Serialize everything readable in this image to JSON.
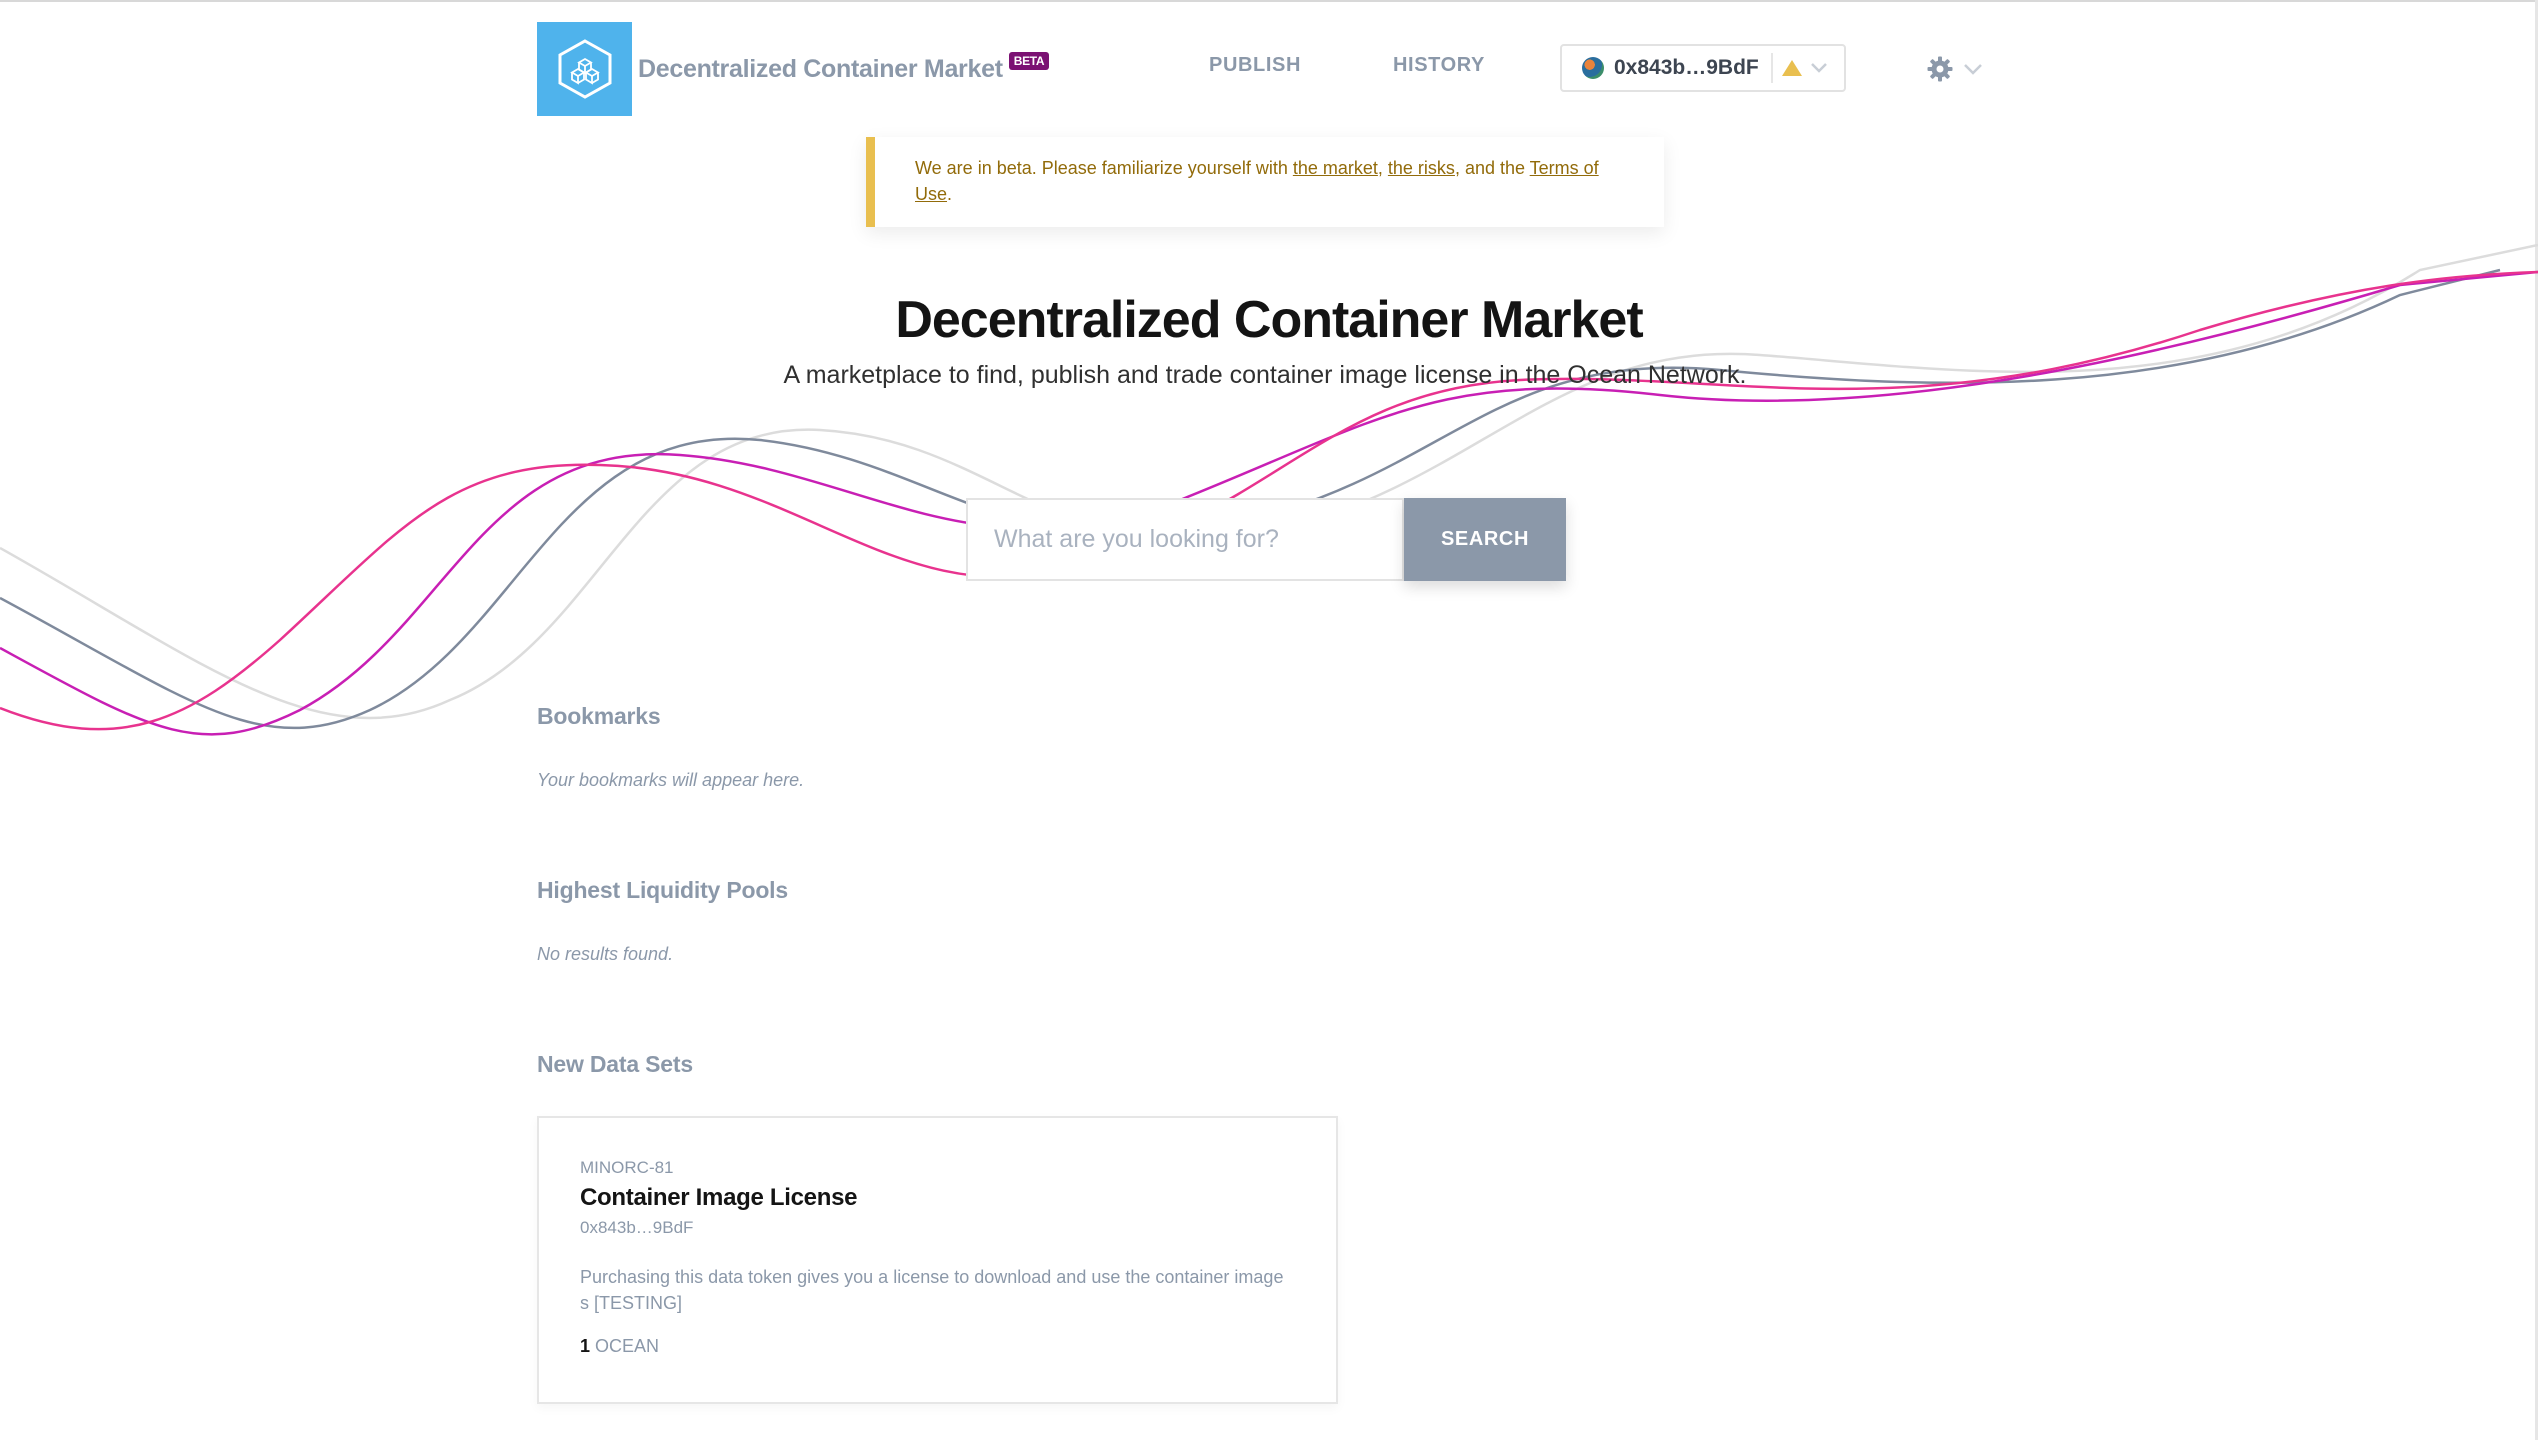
{
  "header": {
    "brand": "Decentralized Container Market",
    "badge": "BETA",
    "nav": [
      {
        "label": "PUBLISH"
      },
      {
        "label": "HISTORY"
      }
    ],
    "wallet": {
      "address": "0x843b…9BdF"
    },
    "settings_icon": "gear-icon"
  },
  "banner": {
    "text_1": "We are in beta. Please familiarize yourself with ",
    "link_market": "the market",
    "text_2": ", ",
    "link_risks": "the risks",
    "text_3": ", and the ",
    "link_terms": "Terms of Use",
    "text_4": "."
  },
  "hero": {
    "title": "Decentralized Container Market",
    "subtitle": "A marketplace to find, publish and trade container image license in the Ocean Network."
  },
  "search": {
    "placeholder": "What are you looking for?",
    "button": "SEARCH"
  },
  "sections": {
    "bookmarks": {
      "title": "Bookmarks",
      "empty": "Your bookmarks will appear here."
    },
    "pools": {
      "title": "Highest Liquidity Pools",
      "empty": "No results found."
    },
    "new_datasets": {
      "title": "New Data Sets"
    }
  },
  "card": {
    "symbol": "MINORC-81",
    "title": "Container Image License",
    "owner": "0x843b…9BdF",
    "description": "Purchasing this data token gives you a license to download and use the container images [TESTING]",
    "price_value": "1",
    "price_unit": "OCEAN"
  },
  "colors": {
    "accent_blue": "#4fb3ec",
    "muted_grey": "#8b98a9",
    "beta_purple": "#7b1173",
    "banner_yellow": "#e9bf4f",
    "wave_pink": "#e8338e",
    "wave_magenta": "#c81fb4"
  }
}
